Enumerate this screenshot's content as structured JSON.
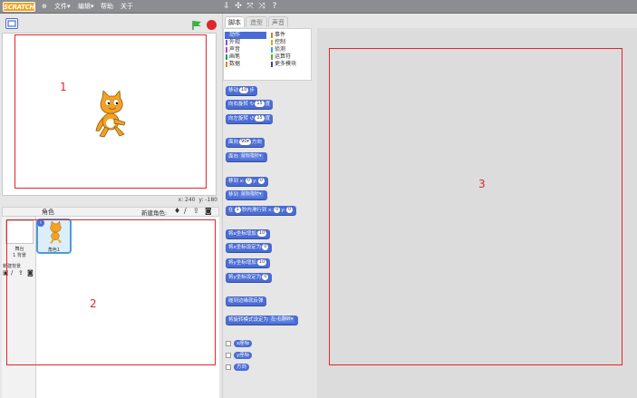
{
  "app": {
    "logo_text": "SCRATCH",
    "menus": [
      "文件▾",
      "编辑▾",
      "帮助",
      "关于"
    ],
    "toolbar_icons": [
      "duplicate-icon",
      "cut-icon",
      "grow-icon",
      "shrink-icon",
      "help-icon"
    ]
  },
  "stage": {
    "x_label": "x: 240",
    "y_label": "y: -180",
    "region_label": "1"
  },
  "sprites": {
    "header_label": "角色",
    "new_sprite_label": "新建角色:",
    "stage_thumb_label": "舞台\n1 背景",
    "new_backdrop_label": "新建背景",
    "sprite_name": "角色1",
    "sprite_badge": "i",
    "region_label": "2"
  },
  "palette": {
    "tabs": [
      "脚本",
      "造型",
      "声音"
    ],
    "categories_left": [
      {
        "label": "动作",
        "color": "#4a6cd4",
        "selected": true
      },
      {
        "label": "外观",
        "color": "#8a55d7"
      },
      {
        "label": "声音",
        "color": "#bb42c3"
      },
      {
        "label": "画笔",
        "color": "#0e9a6c"
      },
      {
        "label": "数据",
        "color": "#ee7d16"
      }
    ],
    "categories_right": [
      {
        "label": "事件",
        "color": "#c88330"
      },
      {
        "label": "控制",
        "color": "#e1a91a"
      },
      {
        "label": "侦测",
        "color": "#2ca5e2"
      },
      {
        "label": "运算符",
        "color": "#5cb712"
      },
      {
        "label": "更多模块",
        "color": "#632d99"
      }
    ],
    "blocks": {
      "move": "移动",
      "move_val": "10",
      "move_unit": "步",
      "turn_right": "向右旋转",
      "turn_right_val": "15",
      "turn_right_unit": "度",
      "turn_left": "向左旋转",
      "turn_left_val": "15",
      "turn_left_unit": "度",
      "point_dir": "面向",
      "point_dir_val": "90▾",
      "point_dir_unit": "方向",
      "point_towards": "面向",
      "point_towards_val": "鼠标指针▾",
      "goto_xy": "移到 x:",
      "goto_x": "0",
      "goto_y_label": "y:",
      "goto_y": "0",
      "goto": "移到",
      "goto_val": "鼠标指针▾",
      "glide": "在",
      "glide_val": "1",
      "glide_mid": "秒内滑行到 x:",
      "glide_x": "0",
      "glide_y_label": "y:",
      "glide_y": "0",
      "change_x": "将x坐标增加",
      "change_x_val": "10",
      "set_x": "将x坐标设定为",
      "set_x_val": "0",
      "change_y": "将y坐标增加",
      "change_y_val": "10",
      "set_y": "将y坐标设定为",
      "set_y_val": "0",
      "bounce": "碰到边缘就反弹",
      "rotation_style": "将旋转模式设定为",
      "rotation_style_val": "左-右翻转▾",
      "rep_x": "x座标",
      "rep_y": "y座标",
      "rep_dir": "方向"
    }
  },
  "scripts": {
    "region_label": "3"
  }
}
